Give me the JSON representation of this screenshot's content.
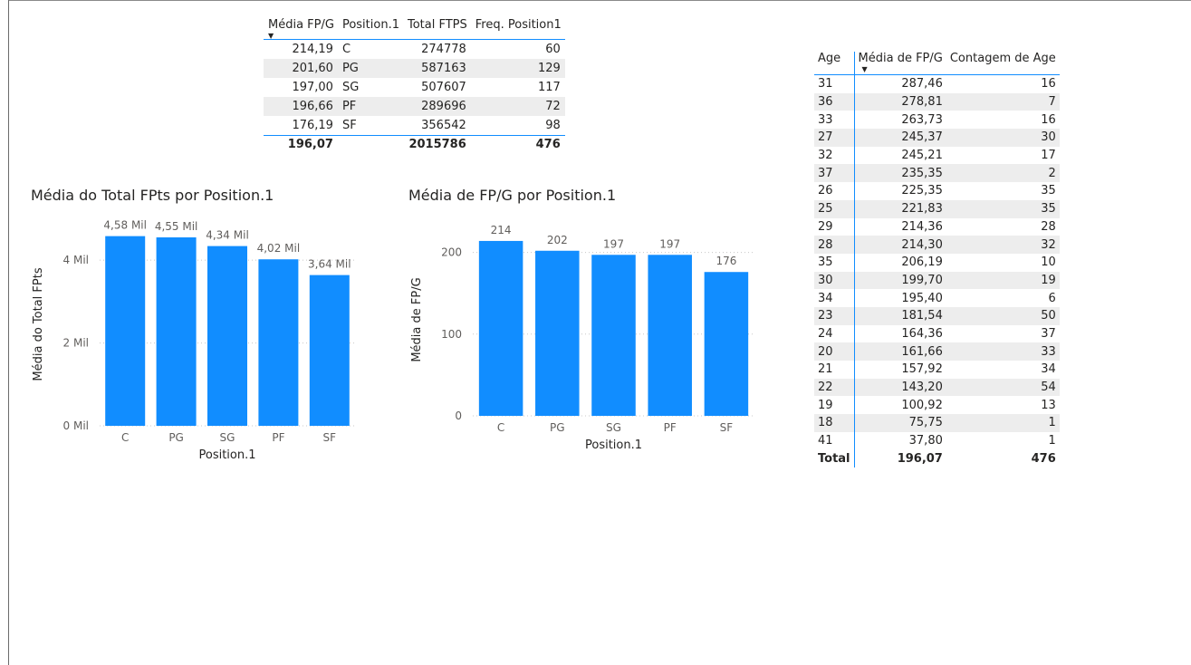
{
  "position_table": {
    "headers": [
      "Média FP/G",
      "Position.1",
      "Total FTPS",
      "Freq. Position1"
    ],
    "rows": [
      [
        "214,19",
        "C",
        "274778",
        "60"
      ],
      [
        "201,60",
        "PG",
        "587163",
        "129"
      ],
      [
        "197,00",
        "SG",
        "507607",
        "117"
      ],
      [
        "196,66",
        "PF",
        "289696",
        "72"
      ],
      [
        "176,19",
        "SF",
        "356542",
        "98"
      ]
    ],
    "total": [
      "196,07",
      "",
      "2015786",
      "476"
    ]
  },
  "age_table": {
    "headers": [
      "Age",
      "Média de FP/G",
      "Contagem de Age"
    ],
    "rows": [
      [
        "31",
        "287,46",
        "16"
      ],
      [
        "36",
        "278,81",
        "7"
      ],
      [
        "33",
        "263,73",
        "16"
      ],
      [
        "27",
        "245,37",
        "30"
      ],
      [
        "32",
        "245,21",
        "17"
      ],
      [
        "37",
        "235,35",
        "2"
      ],
      [
        "26",
        "225,35",
        "35"
      ],
      [
        "25",
        "221,83",
        "35"
      ],
      [
        "29",
        "214,36",
        "28"
      ],
      [
        "28",
        "214,30",
        "32"
      ],
      [
        "35",
        "206,19",
        "10"
      ],
      [
        "30",
        "199,70",
        "19"
      ],
      [
        "34",
        "195,40",
        "6"
      ],
      [
        "23",
        "181,54",
        "50"
      ],
      [
        "24",
        "164,36",
        "37"
      ],
      [
        "20",
        "161,66",
        "33"
      ],
      [
        "21",
        "157,92",
        "34"
      ],
      [
        "22",
        "143,20",
        "54"
      ],
      [
        "19",
        "100,92",
        "13"
      ],
      [
        "18",
        "75,75",
        "1"
      ],
      [
        "41",
        "37,80",
        "1"
      ]
    ],
    "total": [
      "Total",
      "196,07",
      "476"
    ]
  },
  "chart_data": [
    {
      "type": "bar",
      "title": "Média do Total FPts por Position.1",
      "xlabel": "Position.1",
      "ylabel": "Média do Total FPts",
      "categories": [
        "C",
        "PG",
        "SG",
        "PF",
        "SF"
      ],
      "values": [
        4580,
        4550,
        4340,
        4020,
        3640
      ],
      "data_labels": [
        "4,58 Mil",
        "4,55 Mil",
        "4,34 Mil",
        "4,02 Mil",
        "3,64 Mil"
      ],
      "ylim": [
        0,
        4900
      ],
      "yticks": [
        0,
        2000,
        4000
      ],
      "ytick_labels": [
        "0 Mil",
        "2 Mil",
        "4 Mil"
      ],
      "grid": true,
      "color": "#118dff"
    },
    {
      "type": "bar",
      "title": "Média de FP/G por Position.1",
      "xlabel": "Position.1",
      "ylabel": "Média de FP/G",
      "categories": [
        "C",
        "PG",
        "SG",
        "PF",
        "SF"
      ],
      "values": [
        214,
        202,
        197,
        197,
        176
      ],
      "data_labels": [
        "214",
        "202",
        "197",
        "197",
        "176"
      ],
      "ylim": [
        0,
        235
      ],
      "yticks": [
        0,
        100,
        200
      ],
      "ytick_labels": [
        "0",
        "100",
        "200"
      ],
      "grid": true,
      "color": "#118dff"
    }
  ]
}
